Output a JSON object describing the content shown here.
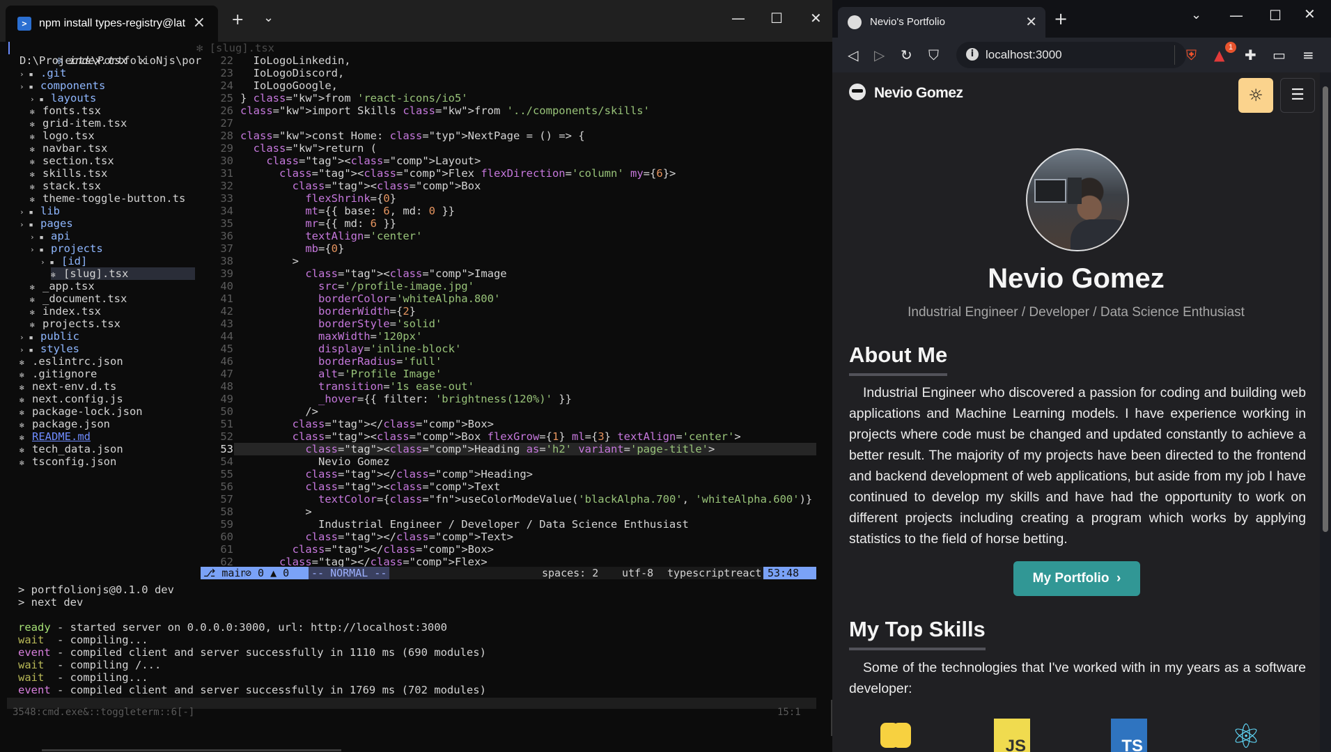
{
  "terminal": {
    "tab_title": "npm install types-registry@lat",
    "new_tab": "+",
    "dropdown": "⌄",
    "controls": {
      "minimize": "—",
      "maximize": "☐",
      "close": "✕"
    }
  },
  "editor": {
    "open_files": [
      "index.tsx",
      "[slug].tsx"
    ],
    "root_path": "D:\\Projects\\PortfolioNjs\\por",
    "tree": [
      {
        "name": ".git",
        "kind": "dir",
        "indent": 1
      },
      {
        "name": "components",
        "kind": "dir",
        "indent": 1
      },
      {
        "name": "layouts",
        "kind": "dir",
        "indent": 2
      },
      {
        "name": "fonts.tsx",
        "kind": "file",
        "indent": 2
      },
      {
        "name": "grid-item.tsx",
        "kind": "file",
        "indent": 2
      },
      {
        "name": "logo.tsx",
        "kind": "file",
        "indent": 2
      },
      {
        "name": "navbar.tsx",
        "kind": "file",
        "indent": 2
      },
      {
        "name": "section.tsx",
        "kind": "file",
        "indent": 2
      },
      {
        "name": "skills.tsx",
        "kind": "file",
        "indent": 2
      },
      {
        "name": "stack.tsx",
        "kind": "file",
        "indent": 2
      },
      {
        "name": "theme-toggle-button.ts",
        "kind": "file",
        "indent": 2
      },
      {
        "name": "lib",
        "kind": "dir",
        "indent": 1
      },
      {
        "name": "pages",
        "kind": "dir",
        "indent": 1
      },
      {
        "name": "api",
        "kind": "dir",
        "indent": 2
      },
      {
        "name": "projects",
        "kind": "dir",
        "indent": 2
      },
      {
        "name": "[id]",
        "kind": "dir",
        "indent": 3
      },
      {
        "name": "[slug].tsx",
        "kind": "file",
        "indent": 4
      },
      {
        "name": "_app.tsx",
        "kind": "file",
        "indent": 2
      },
      {
        "name": "_document.tsx",
        "kind": "file",
        "indent": 2
      },
      {
        "name": "index.tsx",
        "kind": "file",
        "indent": 2
      },
      {
        "name": "projects.tsx",
        "kind": "file",
        "indent": 2
      },
      {
        "name": "public",
        "kind": "dir",
        "indent": 1
      },
      {
        "name": "styles",
        "kind": "dir",
        "indent": 1
      },
      {
        "name": ".eslintrc.json",
        "kind": "file",
        "indent": 1
      },
      {
        "name": ".gitignore",
        "kind": "file",
        "indent": 1
      },
      {
        "name": "next-env.d.ts",
        "kind": "file",
        "indent": 1
      },
      {
        "name": "next.config.js",
        "kind": "file",
        "indent": 1
      },
      {
        "name": "package-lock.json",
        "kind": "file",
        "indent": 1
      },
      {
        "name": "package.json",
        "kind": "file",
        "indent": 1
      },
      {
        "name": "README.md",
        "kind": "file",
        "indent": 1
      },
      {
        "name": "tech_data.json",
        "kind": "file",
        "indent": 1
      },
      {
        "name": "tsconfig.json",
        "kind": "file",
        "indent": 1
      }
    ],
    "first_line_number": 22,
    "current_line": 53,
    "code": [
      "  IoLogoLinkedin,",
      "  IoLogoDiscord,",
      "  IoLogoGoogle,",
      "} from 'react-icons/io5'",
      "import Skills from '../components/skills'",
      "",
      "const Home: NextPage = () => {",
      "  return (",
      "    <Layout>",
      "      <Flex flexDirection='column' my={6}>",
      "        <Box",
      "          flexShrink={0}",
      "          mt={{ base: 6, md: 0 }}",
      "          mr={{ md: 6 }}",
      "          textAlign='center'",
      "          mb={0}",
      "        >",
      "          <Image",
      "            src='/profile-image.jpg'",
      "            borderColor='whiteAlpha.800'",
      "            borderWidth={2}",
      "            borderStyle='solid'",
      "            maxWidth='120px'",
      "            display='inline-block'",
      "            borderRadius='full'",
      "            alt='Profile Image'",
      "            transition='1s ease-out'",
      "            _hover={{ filter: 'brightness(120%)' }}",
      "          />",
      "        </Box>",
      "        <Box flexGrow={1} ml={3} textAlign='center'>",
      "          <Heading as='h2' variant='page-title'>",
      "            Nevio Gomez",
      "          </Heading>",
      "          <Text",
      "            textColor={useColorModeValue('blackAlpha.700', 'whiteAlpha.600')}",
      "          >",
      "            Industrial Engineer / Developer / Data Science Enthusiast",
      "          </Text>",
      "        </Box>",
      "      </Flex>"
    ],
    "status": {
      "branch": "main",
      "diagnostics": "⊘ 0 ▲ 0",
      "mode": "-- NORMAL --",
      "spaces": "spaces: 2",
      "encoding": "utf-8",
      "filetype": "typescriptreact",
      "position": "53:48"
    }
  },
  "term_output": [
    {
      "k": "",
      "t": "> portfolionjs@0.1.0 dev"
    },
    {
      "k": "",
      "t": "> next dev"
    },
    {
      "k": "",
      "t": ""
    },
    {
      "k": "ready",
      "t": " - started server on 0.0.0.0:3000, url: http://localhost:3000"
    },
    {
      "k": "wait",
      "t": "  - compiling..."
    },
    {
      "k": "event",
      "t": " - compiled client and server successfully in 1110 ms (690 modules)"
    },
    {
      "k": "wait",
      "t": "  - compiling /..."
    },
    {
      "k": "wait",
      "t": "  - compiling..."
    },
    {
      "k": "event",
      "t": " - compiled client and server successfully in 1769 ms (702 modules)"
    }
  ],
  "term_footer": {
    "left": "3548:cmd.exe&::toggleterm::6[-]",
    "right": "15:1"
  },
  "browser": {
    "tab_title": "Nevio's Portfolio",
    "url": "localhost:3000",
    "brave_badge": "1"
  },
  "site": {
    "logo": "Nevio Gomez",
    "name": "Nevio Gomez",
    "subtitle": "Industrial Engineer / Developer / Data Science Enthusiast",
    "about_title": "About Me",
    "about_text": "Industrial Engineer who discovered a passion for coding and building web applications and Machine Learning models. I have experience working in projects where code must be changed and updated constantly to achieve a better result. The majority of my projects have been directed to the frontend and backend development of web applications, but aside from my job I have continued to develop my skills and have had the opportunity to work on different projects including creating a program which works by applying statistics to the field of horse betting.",
    "portfolio_button": "My Portfolio",
    "skills_title": "My Top Skills",
    "skills_text": "Some of the technologies that I've worked with in my years as a software developer:",
    "skills": [
      "python-icon",
      "javascript-icon",
      "typescript-icon",
      "react-icon"
    ],
    "skill_labels": {
      "js": "JS",
      "ts": "TS"
    }
  }
}
